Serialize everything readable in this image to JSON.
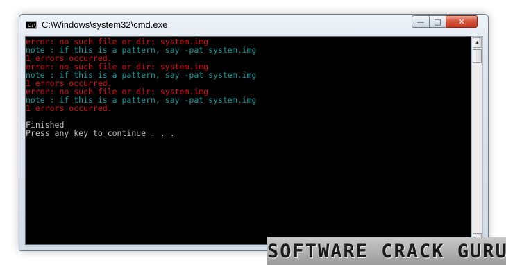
{
  "window": {
    "title": "C:\\Windows\\system32\\cmd.exe",
    "app_icon_text": "C:\\"
  },
  "controls": {
    "minimize": "—",
    "maximize": "□",
    "close": "✕"
  },
  "colors": {
    "console_bg": "#000000",
    "error_text": "#e01010",
    "note_text": "#1a9a9a",
    "normal_text": "#c0c0c0"
  },
  "console": {
    "lines": [
      {
        "text": "error: no such file or dir: system.img",
        "kind": "error"
      },
      {
        "text": "note : if this is a pattern, say -pat system.img",
        "kind": "note"
      },
      {
        "text": "1 errors occurred.",
        "kind": "error"
      },
      {
        "text": "error: no such file or dir: system.img",
        "kind": "error"
      },
      {
        "text": "note : if this is a pattern, say -pat system.img",
        "kind": "note"
      },
      {
        "text": "1 errors occurred.",
        "kind": "error"
      },
      {
        "text": "error: no such file or dir: system.img",
        "kind": "error"
      },
      {
        "text": "note : if this is a pattern, say -pat system.img",
        "kind": "note"
      },
      {
        "text": "1 errors occurred.",
        "kind": "error"
      },
      {
        "text": "",
        "kind": "normal"
      },
      {
        "text": "Finished",
        "kind": "normal"
      },
      {
        "text": "Press any key to continue . . .",
        "kind": "normal"
      }
    ]
  },
  "scrollbar": {
    "up_arrow": "▲",
    "down_arrow": "▼"
  },
  "watermark": {
    "text": "SOFTWARE CRACK GURU"
  }
}
